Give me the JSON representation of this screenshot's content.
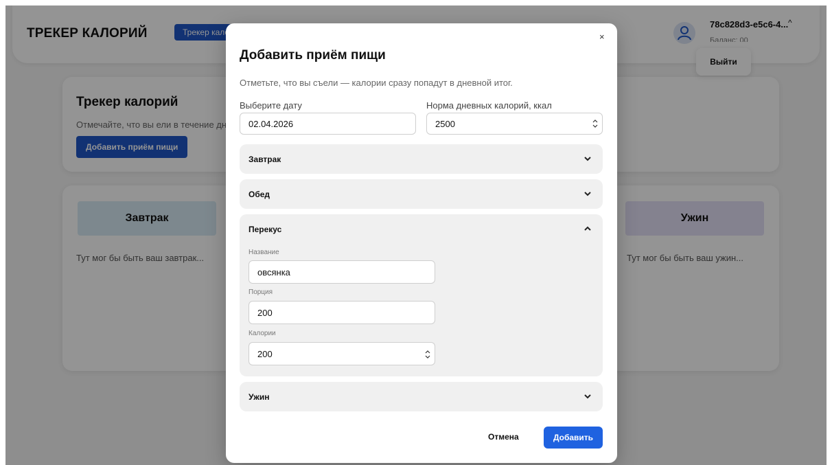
{
  "header": {
    "brand": "ТРЕКЕР КАЛОРИЙ",
    "badge": "Трекер калорий",
    "user_id": "78c828d3-e5c6-4...",
    "balance": "Баланс: 00",
    "logout_label": "Выйти"
  },
  "hero": {
    "title": "Трекер калорий",
    "subtitle": "Отмечайте, что вы ели в течение дня",
    "add_button": "Добавить приём пищи"
  },
  "meals_board": {
    "breakfast_title": "Завтрак",
    "breakfast_placeholder": "Тут мог бы быть ваш завтрак...",
    "dinner_title": "Ужин",
    "dinner_placeholder": "Тут мог бы быть ваш ужин..."
  },
  "modal": {
    "close_label": "×",
    "title": "Добавить приём пищи",
    "subtitle": "Отметьте, что вы съели — калории сразу попадут в дневной итог.",
    "date_label": "Выберите дату",
    "date_value": "02.04.2026",
    "norm_label": "Норма дневных калорий, ккал",
    "norm_value": "2500",
    "sections": {
      "breakfast": "Завтрак",
      "lunch": "Обед",
      "snack": "Перекус",
      "dinner": "Ужин"
    },
    "snack_form": {
      "name_label": "Название",
      "name_value": "овсянка",
      "portion_label": "Порция",
      "portion_value": "200",
      "calories_label": "Калории",
      "calories_value": "200"
    },
    "cancel_label": "Отмена",
    "submit_label": "Добавить"
  },
  "colors": {
    "primary": "#1f62e0",
    "badge": "#1f57c7",
    "breakfast_bg": "#d7ebf5",
    "dinner_bg": "#e3e0f7"
  }
}
